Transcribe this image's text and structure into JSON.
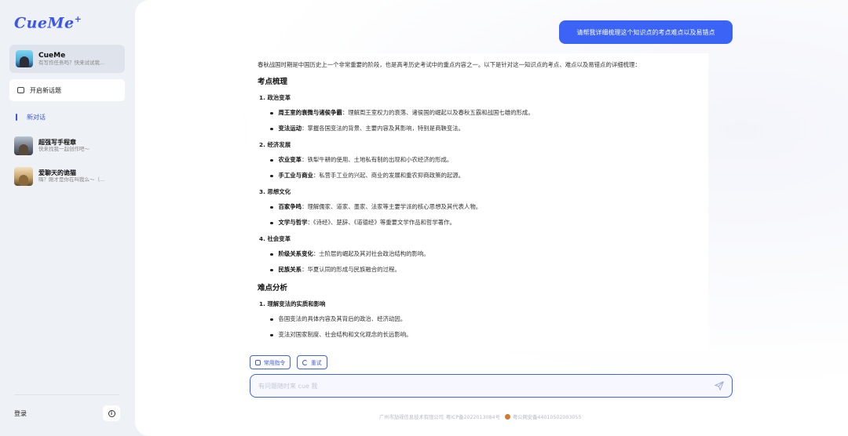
{
  "app": {
    "logo": "CueMe",
    "logo_mark": "+"
  },
  "sidebar": {
    "agent": {
      "name": "CueMe",
      "subtitle": "有写作任务吗？快来试试我..."
    },
    "new_topic_label": "开启新话题",
    "new_chat_label": "新对话",
    "conversations": [
      {
        "title": "超强写手程章",
        "subtitle": "快来找我一起创作吧～"
      },
      {
        "title": "爱聊天的诡猫",
        "subtitle": "嗨？刚才是你在叫我么～（..."
      }
    ],
    "login_label": "登录",
    "info_icon_glyph": "i"
  },
  "chat": {
    "user_message": "请帮我详细梳理这个知识点的考点难点以及易错点",
    "answer": {
      "intro": "春秋战国时期是中国历史上一个非常重要的阶段，也是高考历史考试中的重点内容之一。以下是针对这一知识点的考点、难点以及易错点的详细梳理：",
      "section1_title": "考点梳理",
      "groups": [
        {
          "heading": "1. 政治变革",
          "items": [
            {
              "bold": "周王室的衰微与诸侯争霸",
              "text": "：理解周王室权力的衰落、诸侯国的崛起以及春秋五霸和战国七雄的形成。"
            },
            {
              "bold": "变法运动",
              "text": "：掌握各国变法的背景、主要内容及其影响，特别是商鞅变法。"
            }
          ]
        },
        {
          "heading": "2. 经济发展",
          "items": [
            {
              "bold": "农业变革",
              "text": "：铁犁牛耕的使用、土地私有制的出现和小农经济的形成。"
            },
            {
              "bold": "手工业与商业",
              "text": "：私营手工业的兴起、商业的发展和重农抑商政策的起源。"
            }
          ]
        },
        {
          "heading": "3. 思想文化",
          "items": [
            {
              "bold": "百家争鸣",
              "text": "：理解儒家、道家、墨家、法家等主要学派的核心思想及其代表人物。"
            },
            {
              "bold": "文学与哲学",
              "text": "：《诗经》、楚辞、《道德经》等重要文学作品和哲学著作。"
            }
          ]
        },
        {
          "heading": "4. 社会变革",
          "items": [
            {
              "bold": "阶级关系变化",
              "text": "：士阶层的崛起及其对社会政治结构的影响。"
            },
            {
              "bold": "民族关系",
              "text": "：华夏认同的形成与民族融合的过程。"
            }
          ]
        }
      ],
      "section2_title": "难点分析",
      "group5": {
        "heading": "1. 理解变法的实质和影响",
        "items": [
          {
            "bold": "",
            "text": "各国变法的具体内容及其背后的政治、经济动因。"
          },
          {
            "bold": "",
            "text": "变法对国家制度、社会结构和文化观念的长远影响。"
          }
        ]
      }
    },
    "actions": {
      "common_commands": "常用指令",
      "retry": "重试"
    },
    "input_placeholder": "有问题随时来 cue 我"
  },
  "footer": {
    "company": "广州市劢视信息技术有限公司",
    "icp": "粤ICP备2022013084号",
    "police": "粤公网安备44010502003055"
  },
  "colors": {
    "accent": "#3b63f5",
    "sidebar_bg": "#eef1f6"
  }
}
